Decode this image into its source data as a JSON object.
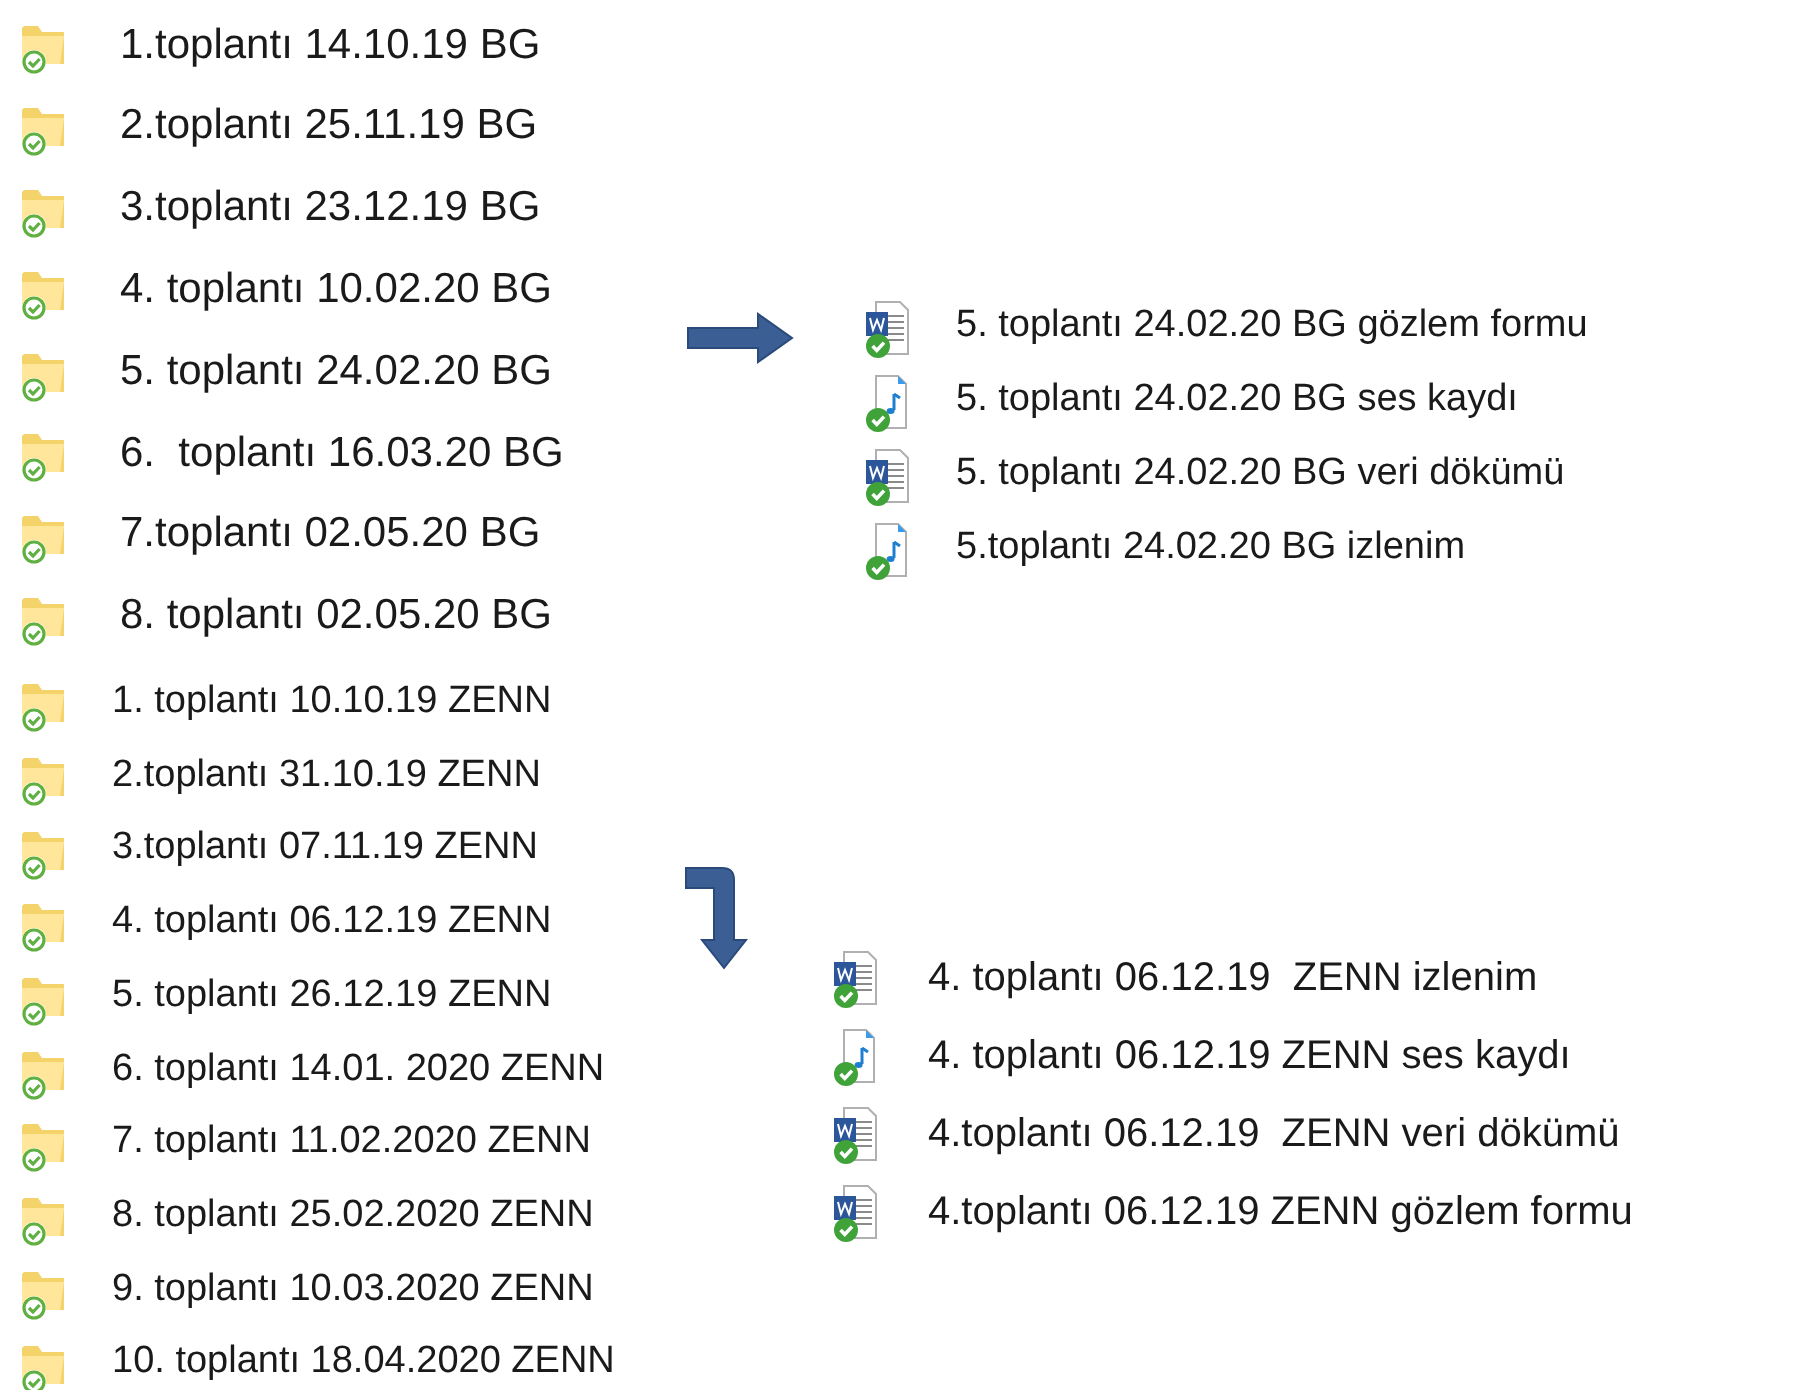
{
  "bg_folders": [
    {
      "name": "1.toplantı 14.10.19 BG"
    },
    {
      "name": "2.toplantı 25.11.19 BG"
    },
    {
      "name": "3.toplantı 23.12.19 BG"
    },
    {
      "name": "4. toplantı 10.02.20 BG"
    },
    {
      "name": "5. toplantı 24.02.20 BG"
    },
    {
      "name": "6.  toplantı 16.03.20 BG"
    },
    {
      "name": "7.toplantı 02.05.20 BG"
    },
    {
      "name": "8. toplantı 02.05.20 BG"
    }
  ],
  "zenn_folders": [
    {
      "name": "1. toplantı 10.10.19 ZENN"
    },
    {
      "name": "2.toplantı 31.10.19 ZENN"
    },
    {
      "name": "3.toplantı 07.11.19 ZENN"
    },
    {
      "name": "4. toplantı 06.12.19 ZENN"
    },
    {
      "name": "5. toplantı 26.12.19 ZENN"
    },
    {
      "name": "6. toplantı 14.01. 2020 ZENN"
    },
    {
      "name": "7. toplantı 11.02.2020 ZENN"
    },
    {
      "name": "8. toplantı 25.02.2020 ZENN"
    },
    {
      "name": "9. toplantı 10.03.2020 ZENN"
    },
    {
      "name": "10. toplantı 18.04.2020 ZENN"
    }
  ],
  "bg_files": [
    {
      "name": "5. toplantı 24.02.20 BG gözlem formu",
      "kind": "document"
    },
    {
      "name": "5. toplantı 24.02.20 BG ses kaydı",
      "kind": "audio"
    },
    {
      "name": "5. toplantı 24.02.20 BG veri dökümü",
      "kind": "document"
    },
    {
      "name": "5.toplantı 24.02.20 BG izlenim",
      "kind": "audio"
    }
  ],
  "zenn_files": [
    {
      "name": "4. toplantı 06.12.19  ZENN izlenim",
      "kind": "document"
    },
    {
      "name": "4. toplantı 06.12.19 ZENN ses kaydı",
      "kind": "audio"
    },
    {
      "name": "4.toplantı 06.12.19  ZENN veri dökümü",
      "kind": "document"
    },
    {
      "name": "4.toplantı 06.12.19 ZENN gözlem formu",
      "kind": "document"
    }
  ]
}
